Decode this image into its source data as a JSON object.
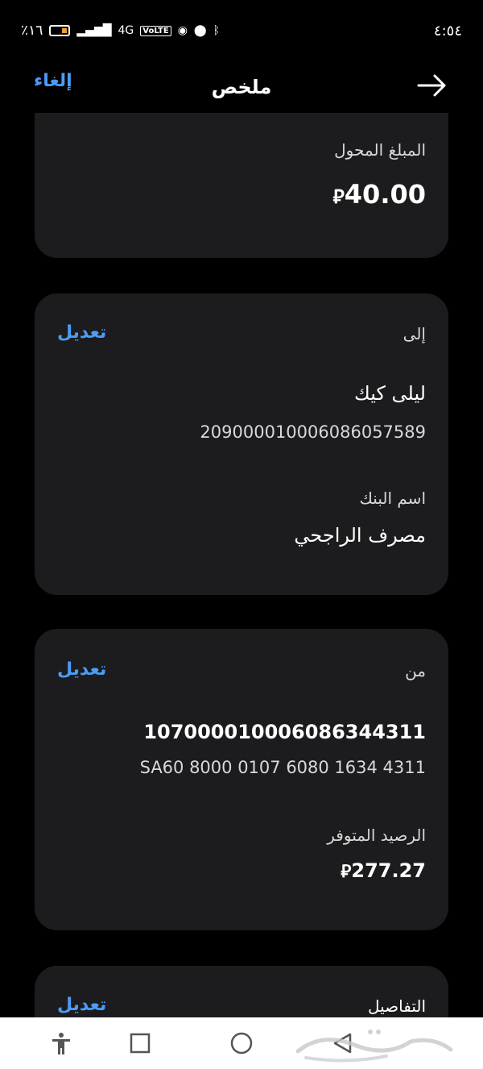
{
  "status_bar": {
    "battery_percent": "٪١٦",
    "network": "4G",
    "time": "٤:٥٤"
  },
  "header": {
    "title": "ملخص",
    "cancel_label": "إلغاء"
  },
  "amount_card": {
    "label": "المبلغ المحول",
    "amount": "40.00"
  },
  "to_card": {
    "label": "إلى",
    "edit_label": "تعديل",
    "recipient_name": "ليلى كيك",
    "account_number": "209000010006086057589",
    "bank_label": "اسم البنك",
    "bank_name": "مصرف الراجحي"
  },
  "from_card": {
    "label": "من",
    "edit_label": "تعديل",
    "account_number": "107000010006086344311",
    "iban": "SA60 8000 0107 6080 1634 4311",
    "balance_label": "الرصيد المتوفر",
    "balance": "277.27"
  },
  "details_card": {
    "label": "التفاصيل",
    "edit_label": "تعديل"
  },
  "currency_symbol": "⃁",
  "colors": {
    "background": "#000000",
    "card": "#1c1c1e",
    "accent": "#4c9cf7"
  }
}
